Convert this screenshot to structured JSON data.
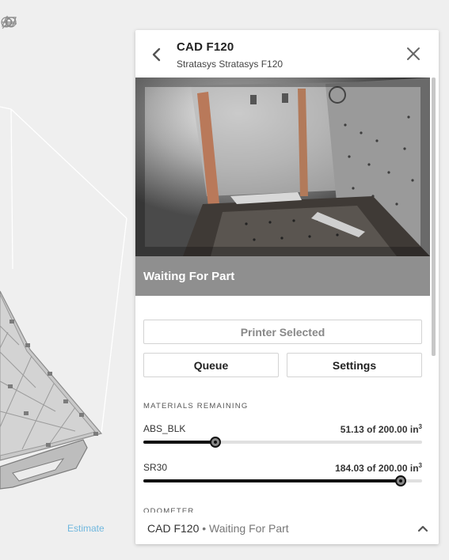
{
  "viewport": {
    "toolbar_icons": [
      "wireframe-view-icon",
      "shaded-view-icon",
      "axes-icon"
    ],
    "estimate_label": "Estimate"
  },
  "panel": {
    "printer_name": "CAD F120",
    "printer_model": "Stratasys Stratasys F120",
    "back_icon": "chevron-left-icon",
    "close_icon": "close-icon",
    "camera_status": "Waiting For Part",
    "printer_selected_label": "Printer Selected",
    "queue_label": "Queue",
    "settings_label": "Settings",
    "materials_heading": "MATERIALS REMAINING",
    "materials": [
      {
        "name": "ABS_BLK",
        "remaining": "51.13",
        "total": "200.00",
        "unit": "in",
        "unit_power": "3",
        "fraction": 0.2557
      },
      {
        "name": "SR30",
        "remaining": "184.03",
        "total": "200.00",
        "unit": "in",
        "unit_power": "3",
        "fraction": 0.9202
      }
    ],
    "odometer_heading": "ODOMETER"
  },
  "footer": {
    "printer_name": "CAD F120",
    "separator": "•",
    "status": "Waiting For Part",
    "chevron_icon": "chevron-up-icon"
  },
  "colors": {
    "accent_link": "#6fb7de",
    "status_bar": "#8f8f8f",
    "progress_fill": "#111111",
    "progress_track": "#e0e0e0"
  }
}
